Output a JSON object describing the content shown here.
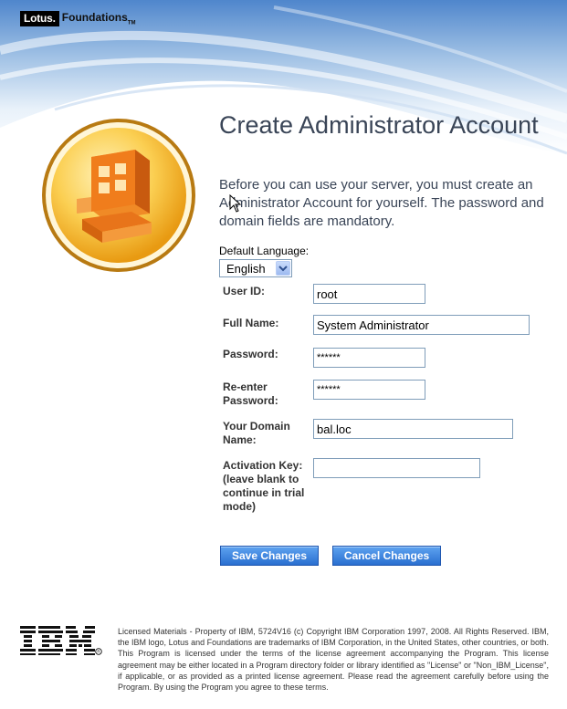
{
  "brand": {
    "lotus": "Lotus.",
    "foundations": "Foundations",
    "tm": "TM"
  },
  "page": {
    "title": "Create Administrator Account",
    "intro": "Before you can use your server, you must create an Administrator Account for yourself. The password and domain fields are mandatory."
  },
  "language": {
    "label": "Default Language:",
    "selected": "English"
  },
  "form": {
    "user_id": {
      "label": "User ID:",
      "value": "root"
    },
    "full_name": {
      "label": "Full Name:",
      "value": "System Administrator"
    },
    "password": {
      "label": "Password:",
      "value": "******"
    },
    "reenter_password": {
      "label_line1": "Re-enter",
      "label_line2": "Password:",
      "value": "******"
    },
    "domain_name": {
      "label_line1": "Your Domain",
      "label_line2": "Name:",
      "value": "bal.loc"
    },
    "activation_key": {
      "label_line1": "Activation Key:",
      "label_line2": "(leave blank to",
      "label_line3": "continue in trial",
      "label_line4": "mode)",
      "value": ""
    }
  },
  "buttons": {
    "save": "Save Changes",
    "cancel": "Cancel Changes"
  },
  "footer": {
    "ibm": "IBM",
    "legal": "Licensed Materials - Property of IBM, 5724V16 (c) Copyright IBM Corporation 1997, 2008. All Rights Reserved. IBM, the IBM logo, Lotus and Foundations are trademarks of IBM Corporation, in the United States, other countries, or both. This Program is licensed under the terms of the license agreement accompanying the Program. This license agreement may be either located in a Program directory folder or library identified as \"License\" or \"Non_IBM_License\", if applicable, or as provided as a printed license agreement. Please read the agreement carefully before using the Program. By using the Program you agree to these terms."
  },
  "colors": {
    "accent": "#2a6fd0",
    "title_text": "#3a4557",
    "emblem": "#f07d1c",
    "emblem_ring": "#f7b733"
  },
  "icons": {
    "emblem": "building-icon",
    "dropdown": "chevron-down-icon",
    "cursor": "mouse-pointer-icon"
  }
}
